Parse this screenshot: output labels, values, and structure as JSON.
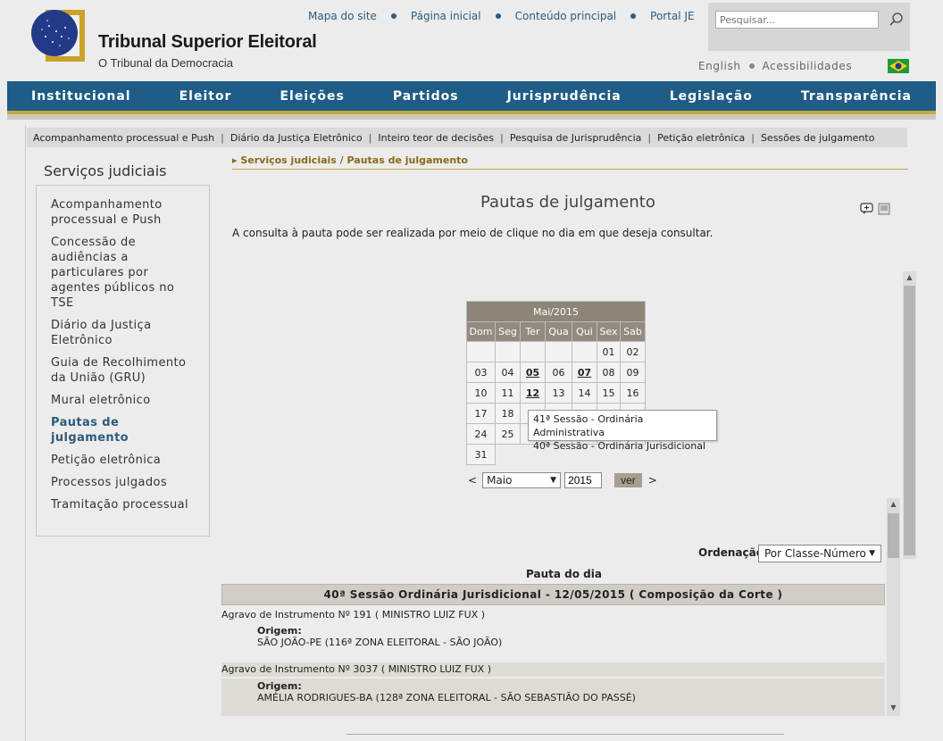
{
  "header": {
    "title": "Tribunal Superior Eleitoral",
    "subtitle": "O Tribunal da Democracia",
    "top_links": [
      "Mapa do site",
      "Página inicial",
      "Conteúdo principal",
      "Portal JE"
    ],
    "search_placeholder": "Pesquisar...",
    "lang_links": [
      "English",
      "Acessibilidades"
    ]
  },
  "main_nav": [
    "Institucional",
    "Eleitor",
    "Eleições",
    "Partidos",
    "Jurisprudência",
    "Legislação",
    "Transparência"
  ],
  "sub_nav": [
    "Acompanhamento processual e Push",
    "Diário da Justiça Eletrônico",
    "Inteiro teor de decisões",
    "Pesquisa de Jurisprudência",
    "Petição eletrônica",
    "Sessões de julgamento"
  ],
  "sidebar": {
    "title": "Serviços judiciais",
    "items": [
      "Acompanhamento processual e Push",
      "Concessão de audiências a particulares por agentes públicos no TSE",
      "Diário da Justiça Eletrônico",
      "Guia de Recolhimento da União (GRU)",
      "Mural eletrônico",
      "Pautas de julgamento",
      "Petição eletrônica",
      "Processos julgados",
      "Tramitação processual"
    ],
    "active_index": 5
  },
  "breadcrumb": "▸ Serviços judiciais / Pautas de julgamento",
  "page_title": "Pautas de julgamento",
  "intro": "A consulta à pauta pode ser realizada por meio de clique no dia em que deseja consultar.",
  "calendar": {
    "header": "Mai/2015",
    "days_of_week": [
      "Dom",
      "Seg",
      "Ter",
      "Qua",
      "Qui",
      "Sex",
      "Sab"
    ],
    "weeks": [
      [
        "",
        "",
        "",
        "",
        "",
        "01",
        "02"
      ],
      [
        "03",
        "04",
        "05",
        "06",
        "07",
        "08",
        "09"
      ],
      [
        "10",
        "11",
        "12",
        "13",
        "14",
        "15",
        "16"
      ],
      [
        "17",
        "18",
        "",
        "",
        "",
        "",
        ""
      ],
      [
        "24",
        "25",
        "",
        "",
        "",
        "",
        ""
      ],
      [
        "31",
        "",
        "",
        "",
        "",
        "",
        ""
      ]
    ],
    "linked_days": [
      "05",
      "07",
      "12"
    ],
    "tooltip": [
      "41ª Sessão - Ordinária Administrativa",
      "40ª Sessão - Ordinária Jurisdicional"
    ],
    "prev": "<",
    "next": ">",
    "month_value": "Maio",
    "year_value": "2015",
    "ver_label": "ver"
  },
  "ordenacao": {
    "label": "Ordenação:",
    "value": "Por Classe-Número"
  },
  "pauta_title": "Pauta do dia",
  "session_header": "40ª Sessão Ordinária Jurisdicional - 12/05/2015 ( Composição da Corte )",
  "processes": [
    {
      "title": "Agravo de Instrumento Nº 191 ( MINISTRO LUIZ FUX )",
      "origin_label": "Origem:",
      "origin": "SÃO JOÃO-PE (116ª ZONA ELEITORAL - SÃO JOÃO)"
    },
    {
      "title": "Agravo de Instrumento Nº 3037 ( MINISTRO LUIZ FUX )",
      "origin_label": "Origem:",
      "origin": "AMÉLIA RODRIGUES-BA (128ª ZONA ELEITORAL - SÃO SEBASTIÃO DO PASSÉ)"
    }
  ],
  "colors": {
    "nav_blue": "#1f5c86",
    "gold": "#c5a93c",
    "calendar_header": "#8d8577"
  }
}
